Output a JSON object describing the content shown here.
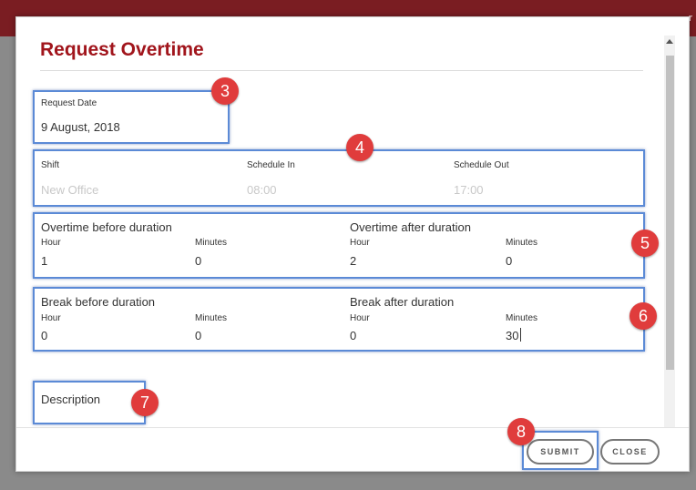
{
  "modal": {
    "title": "Request Overtime"
  },
  "request_date": {
    "label": "Request Date",
    "value": "9 August, 2018"
  },
  "schedule": {
    "shift_label": "Shift",
    "shift_value": "New Office",
    "schedule_in_label": "Schedule In",
    "schedule_in_value": "08:00",
    "schedule_out_label": "Schedule Out",
    "schedule_out_value": "17:00"
  },
  "overtime": {
    "before_title": "Overtime before duration",
    "after_title": "Overtime after duration",
    "hour_label": "Hour",
    "minutes_label": "Minutes",
    "before_hour": "1",
    "before_minutes": "0",
    "after_hour": "2",
    "after_minutes": "0"
  },
  "break": {
    "before_title": "Break before duration",
    "after_title": "Break after duration",
    "hour_label": "Hour",
    "minutes_label": "Minutes",
    "before_hour": "0",
    "before_minutes": "0",
    "after_hour": "0",
    "after_minutes": "30"
  },
  "description": {
    "label": "Description"
  },
  "footer": {
    "submit_label": "SUBMIT",
    "close_label": "CLOSE"
  },
  "annotations": {
    "badge_3": "3",
    "badge_4": "4",
    "badge_5": "5",
    "badge_6": "6",
    "badge_7": "7",
    "badge_8": "8",
    "highlight_color": "#5b8ad6",
    "badge_color": "#e03c3c"
  },
  "colors": {
    "accent": "#a1151c",
    "topbar": "#7a1d22"
  }
}
